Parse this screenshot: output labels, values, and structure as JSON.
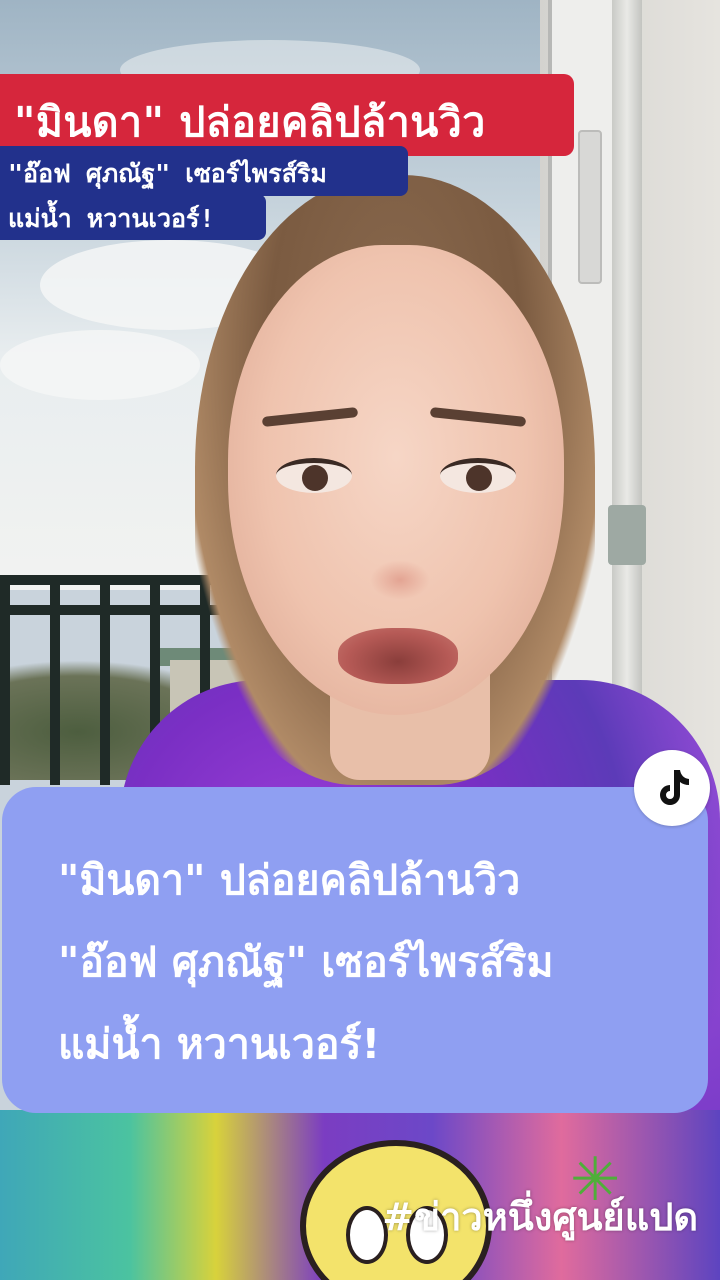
{
  "headline": {
    "banner": "\"มินดา\"  ปล่อยคลิปล้านวิว",
    "subline_1": "\"อ๊อฟ ศุภณัฐ\" เซอร์ไพรส์ริม",
    "subline_2": "แม่น้ำ หวานเวอร์!"
  },
  "caption": {
    "line_1": "\"มินดา\" ปล่อยคลิปล้านวิว",
    "line_2": "\"อ๊อฟ ศุภณัฐ\" เซอร์ไพรส์ริม",
    "line_3": "แม่น้ำ หวานเวอร์!"
  },
  "hashtag": "#ข่าวหนึ่งศูนย์แปด",
  "icons": {
    "app": "tiktok-icon"
  },
  "colors": {
    "banner_red": "#d6263c",
    "subline_blue": "#22318c",
    "caption_bg": "#8f9ff2"
  }
}
